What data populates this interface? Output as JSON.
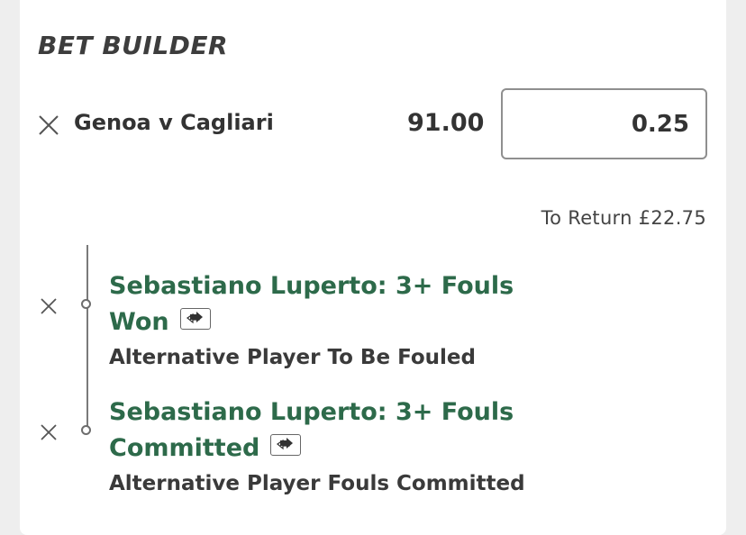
{
  "bet_builder": {
    "title": "BET BUILDER",
    "match": "Genoa v Cagliari",
    "odds": "91.00",
    "stake": "0.25",
    "to_return": "To Return £22.75",
    "selections": [
      {
        "title_line1": "Sebastiano Luperto: 3+ Fouls",
        "title_line2": "Won",
        "market": "Alternative Player To Be Fouled"
      },
      {
        "title_line1": "Sebastiano Luperto: 3+ Fouls",
        "title_line2": "Committed",
        "market": "Alternative Player Fouls Committed"
      }
    ]
  },
  "icons": {
    "remove": "close-icon",
    "swap": "swap-arrows-icon"
  },
  "colors": {
    "selection_green": "#2d6a4a",
    "text_dark": "#333333",
    "background": "#eeeeee"
  }
}
